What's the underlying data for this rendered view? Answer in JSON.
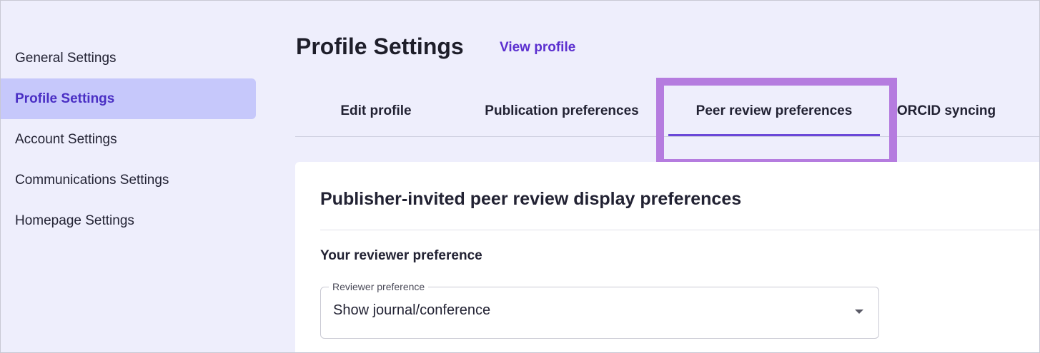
{
  "sidebar": {
    "items": [
      {
        "label": "General Settings"
      },
      {
        "label": "Profile Settings"
      },
      {
        "label": "Account Settings"
      },
      {
        "label": "Communications Settings"
      },
      {
        "label": "Homepage Settings"
      }
    ],
    "active_index": 1
  },
  "header": {
    "title": "Profile Settings",
    "view_profile_link": "View profile"
  },
  "tabs": [
    {
      "label": "Edit profile"
    },
    {
      "label": "Publication preferences"
    },
    {
      "label": "Peer review preferences"
    },
    {
      "label": "ORCID syncing"
    }
  ],
  "active_tab_index": 2,
  "card": {
    "title": "Publisher-invited peer review display preferences",
    "section_label": "Your reviewer preference",
    "select": {
      "legend": "Reviewer preference",
      "value": "Show journal/conference"
    }
  },
  "colors": {
    "accent": "#6a47d8",
    "sidebar_active_bg": "#c6c8fb",
    "highlight_box": "#b57cdf",
    "background": "#eeeefc"
  }
}
